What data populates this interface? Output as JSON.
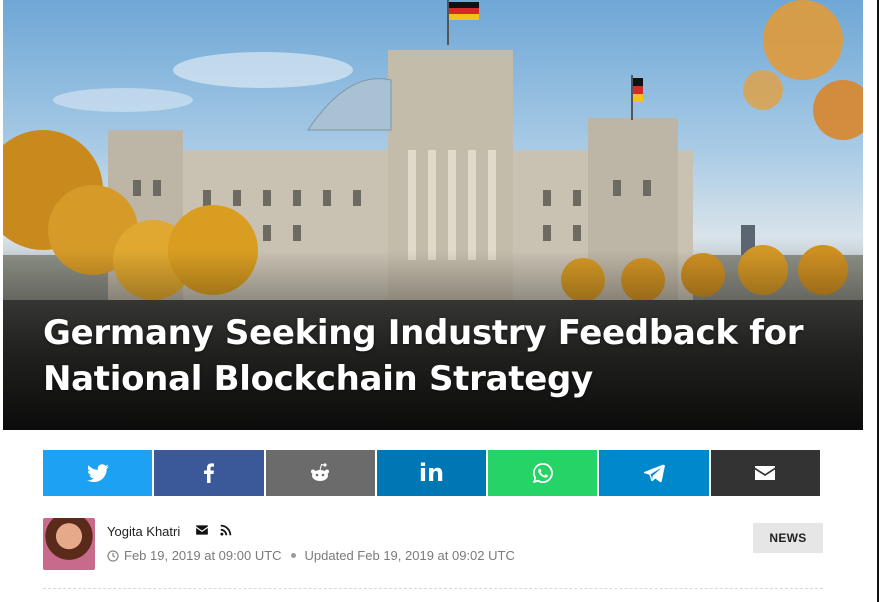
{
  "article": {
    "title": "Germany Seeking Industry Feedback for National Blockchain Strategy",
    "category_badge": "NEWS"
  },
  "share": {
    "buttons": [
      {
        "network": "twitter",
        "icon": "twitter-icon",
        "color": "#1da1f2"
      },
      {
        "network": "facebook",
        "icon": "facebook-icon",
        "color": "#3b5998"
      },
      {
        "network": "reddit",
        "icon": "reddit-icon",
        "color": "#6b6b6b"
      },
      {
        "network": "linkedin",
        "icon": "linkedin-icon",
        "label": "in",
        "color": "#0077b5"
      },
      {
        "network": "whatsapp",
        "icon": "whatsapp-icon",
        "color": "#25d366"
      },
      {
        "network": "telegram",
        "icon": "telegram-icon",
        "color": "#0088cc"
      },
      {
        "network": "email",
        "icon": "envelope-icon",
        "color": "#333333"
      }
    ]
  },
  "author": {
    "name": "Yogita Khatri",
    "icons": [
      "envelope-icon",
      "rss-icon"
    ],
    "published": "Feb 19, 2019 at 09:00 UTC",
    "updated": "Updated Feb 19, 2019 at 09:02 UTC"
  }
}
